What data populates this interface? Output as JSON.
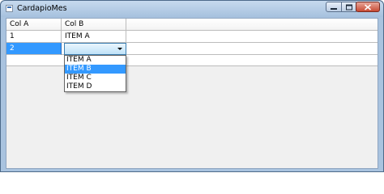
{
  "window": {
    "title": "CardapioMes",
    "icon": "app-window-icon",
    "controls": [
      "minimize-icon",
      "maximize-icon",
      "close-icon"
    ]
  },
  "grid": {
    "columns": [
      "Col A",
      "Col B",
      ""
    ],
    "rows": [
      {
        "col_a": "1",
        "col_b": "ITEM A"
      },
      {
        "col_a": "2",
        "col_b": ""
      }
    ],
    "selected_row_index": 1
  },
  "dropdown": {
    "options": [
      "ITEM A",
      "ITEM B",
      "ITEM C",
      "ITEM D"
    ],
    "highlighted": "ITEM B"
  },
  "colors": {
    "selection": "#3399ff",
    "title_bar": "#a9c3df",
    "client_background": "#f0f0f0",
    "close_button": "#c84a33"
  }
}
